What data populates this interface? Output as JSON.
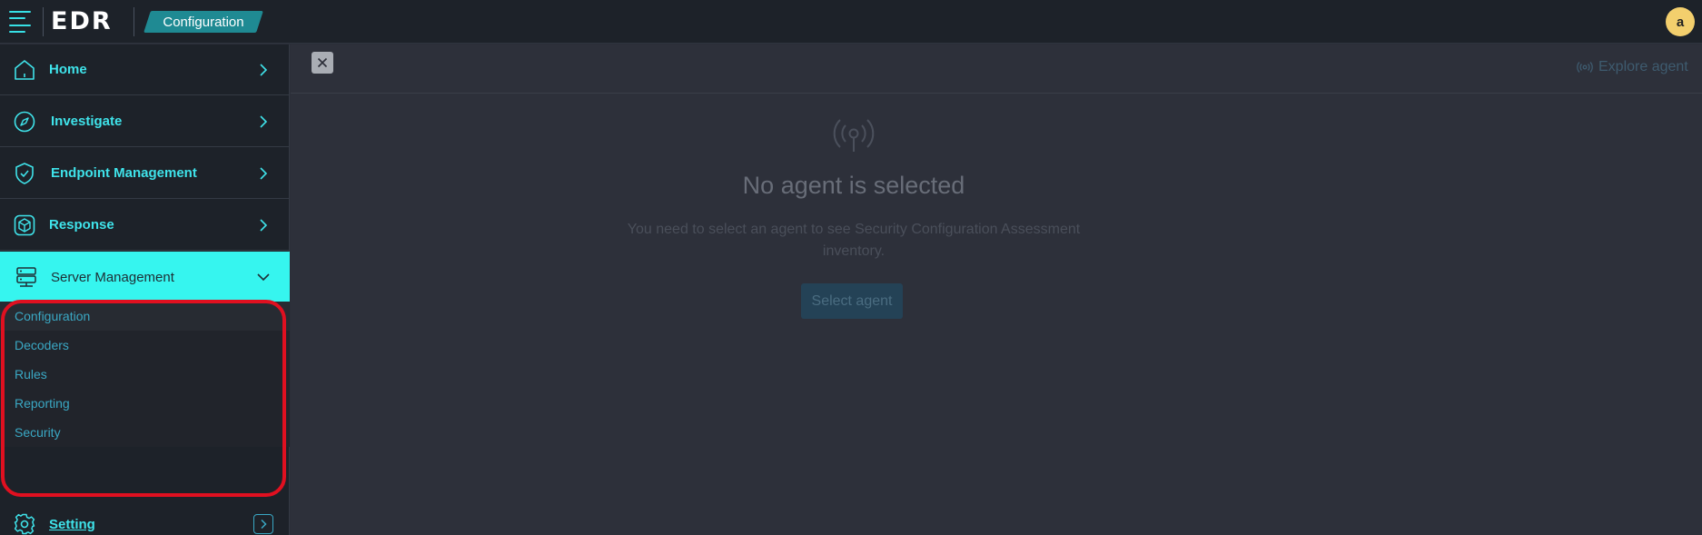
{
  "app": {
    "logo": "EDR",
    "breadcrumb": "Configuration",
    "user_initial": "a"
  },
  "sidebar": {
    "items": [
      {
        "label": "Home",
        "icon": "home-icon"
      },
      {
        "label": "Investigate",
        "icon": "compass-icon"
      },
      {
        "label": "Endpoint Management",
        "icon": "shield-check-icon"
      },
      {
        "label": "Response",
        "icon": "cube-icon"
      },
      {
        "label": "Server Management",
        "icon": "server-icon",
        "expanded": true
      }
    ],
    "submenu": [
      "Configuration",
      "Decoders",
      "Rules",
      "Reporting",
      "Security"
    ],
    "setting": {
      "label": "Setting",
      "icon": "gear-icon"
    }
  },
  "main": {
    "explore_agent": "Explore agent",
    "empty_title": "No agent is selected",
    "empty_desc": "You need to select an agent to see Security Configuration Assessment inventory.",
    "select_agent": "Select agent"
  },
  "colors": {
    "accent": "#36f5ef",
    "sidebar_bg": "#1d2229",
    "main_bg": "#2d303a",
    "breadcrumb_bg": "#1f8a93",
    "avatar_bg": "#f3cf6d",
    "highlight": "#e01020"
  }
}
